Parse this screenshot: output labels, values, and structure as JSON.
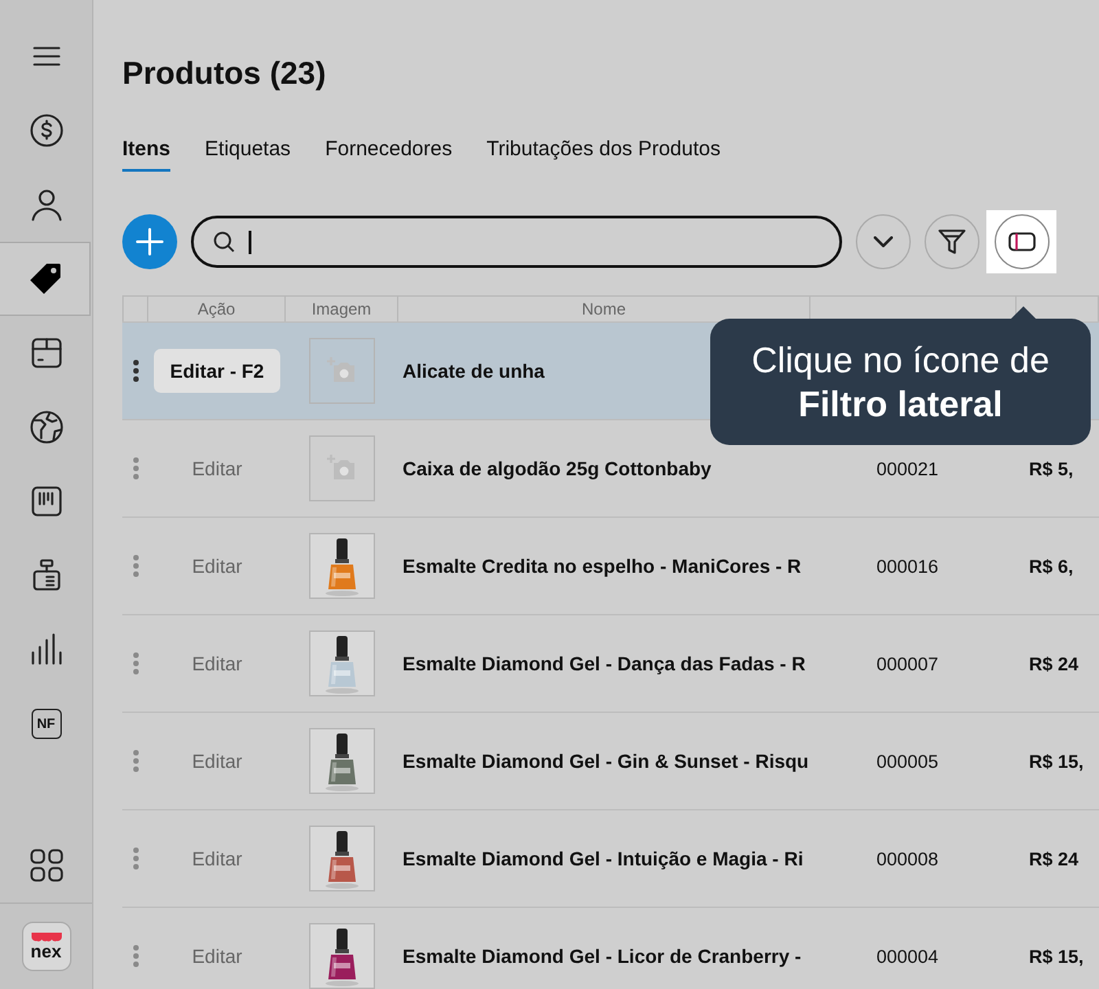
{
  "sidebar": {
    "items": [
      {
        "selected": false
      },
      {
        "selected": false
      },
      {
        "selected": true
      },
      {
        "selected": false
      },
      {
        "selected": false
      },
      {
        "selected": false
      },
      {
        "selected": false
      },
      {
        "selected": false
      },
      {
        "label": "NF",
        "selected": false
      }
    ],
    "logo": "nex"
  },
  "page": {
    "title": "Produtos (23)"
  },
  "tabs": [
    {
      "label": "Itens",
      "selected": true
    },
    {
      "label": "Etiquetas",
      "selected": false
    },
    {
      "label": "Fornecedores",
      "selected": false
    },
    {
      "label": "Tributações dos Produtos",
      "selected": false
    }
  ],
  "tooltip": {
    "text": "Clique no ícone de **Filtro lateral**"
  },
  "table": {
    "columns": [
      "",
      "Ação",
      "Imagem",
      "Nome",
      "",
      ""
    ],
    "rows": [
      {
        "action": "Editar - F2",
        "kind": "placeholder",
        "name": "Alicate de unha",
        "selected": true
      },
      {
        "action": "Editar",
        "kind": "placeholder",
        "name": "Caixa de algodão 25g Cottonbaby",
        "code": "000021",
        "price": "R$ 5,",
        "selected": false
      },
      {
        "action": "Editar",
        "kind": "picture",
        "name": "Esmalte Credita no espelho - ManiCores - R",
        "code": "000016",
        "price": "R$ 6,",
        "selected": false
      },
      {
        "action": "Editar",
        "kind": "picture",
        "name": "Esmalte Diamond Gel - Dança das Fadas - R",
        "code": "000007",
        "price": "R$ 24",
        "selected": false
      },
      {
        "action": "Editar",
        "kind": "picture",
        "name": "Esmalte Diamond Gel - Gin & Sunset - Risqu",
        "code": "000005",
        "price": "R$ 15,",
        "selected": false
      },
      {
        "action": "Editar",
        "kind": "picture",
        "name": "Esmalte Diamond Gel - Intuição e Magia - Ri",
        "code": "000008",
        "price": "R$ 24",
        "selected": false
      },
      {
        "action": "Editar",
        "kind": "picture",
        "name": "Esmalte Diamond Gel - Licor de Cranberry -",
        "code": "000004",
        "price": "R$ 15,",
        "selected": false
      }
    ]
  }
}
